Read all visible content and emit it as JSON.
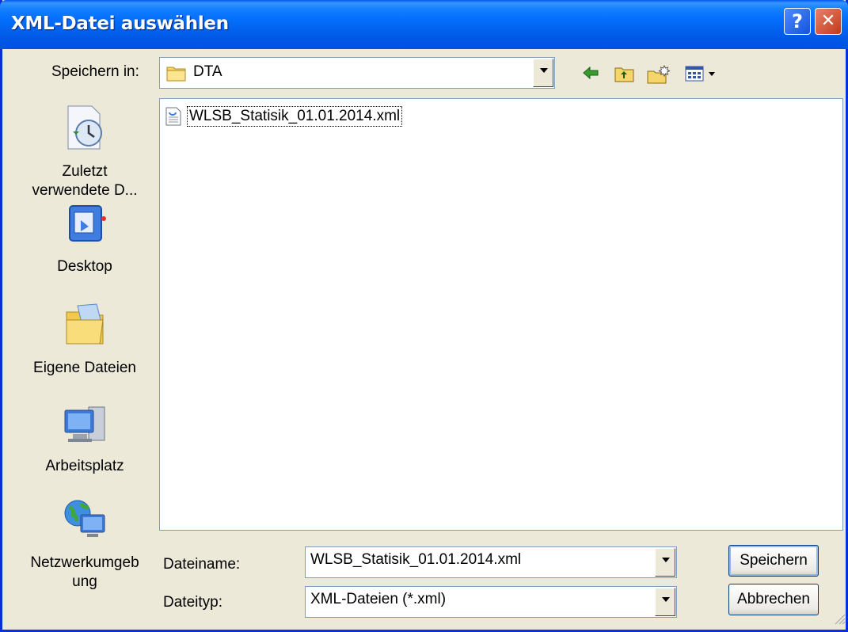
{
  "window": {
    "title": "XML-Datei auswählen",
    "help_glyph": "?",
    "close_glyph": "✕"
  },
  "toolbar": {
    "save_in_label": "Speichern in:",
    "location": "DTA",
    "icons": [
      "back-icon",
      "up-folder-icon",
      "new-folder-icon",
      "view-menu-icon"
    ]
  },
  "sidebar": {
    "items": [
      {
        "label": "Zuletzt verwendete D...",
        "icon": "recent-documents-icon"
      },
      {
        "label": "Desktop",
        "icon": "desktop-icon"
      },
      {
        "label": "Eigene Dateien",
        "icon": "my-documents-icon"
      },
      {
        "label": "Arbeitsplatz",
        "icon": "my-computer-icon"
      },
      {
        "label": "Netzwerkumgeb ung",
        "icon": "network-places-icon"
      }
    ]
  },
  "files": [
    {
      "name": "WLSB_Statisik_01.01.2014.xml",
      "icon": "xml-file-icon"
    }
  ],
  "form": {
    "filename_label": "Dateiname:",
    "filename_value": "WLSB_Statisik_01.01.2014.xml",
    "filetype_label": "Dateityp:",
    "filetype_value": "XML-Dateien (*.xml)"
  },
  "buttons": {
    "save": "Speichern",
    "cancel": "Abbrechen"
  },
  "colors": {
    "titlebar": "#0054E3",
    "window_bg": "#ECE9D8",
    "close_button": "#C23A1A"
  }
}
